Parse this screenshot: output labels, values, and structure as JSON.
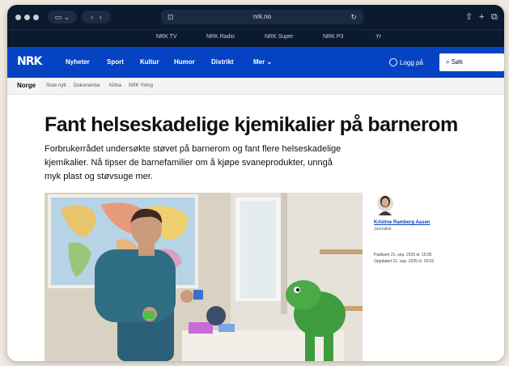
{
  "browser": {
    "url": "nrk.no",
    "colors": {
      "toolbar": "#0b1a2f",
      "accent": "#0643c2"
    }
  },
  "services": [
    "NRK TV",
    "NRK Radio",
    "NRK Super",
    "NRK P3",
    "Yr"
  ],
  "nav": {
    "logo": "NRK",
    "items": [
      "Nyheter",
      "Sport",
      "Kultur",
      "Humor",
      "Distrikt",
      "Mer"
    ],
    "login": "Logg på",
    "search": "Søk"
  },
  "subnav": {
    "title": "Norge",
    "items": [
      "Siste nytt",
      "Dokumentar",
      "Klima",
      "NRK Ytring"
    ]
  },
  "article": {
    "headline": "Fant helseskadelige kjemikalier på barnerom",
    "lead": "Forbrukerrådet undersøkte støvet på barnerom og fant flere helseskadelige kjemikalier. Nå tipser de barnefamilier om å kjøpe svaneprodukter, unngå myk plast og støvsuge mer.",
    "author": "Kristine Ramberg Aasen",
    "author_role": "Journalist",
    "published": "Publisert 21. sep. 2025 kl. 15:00",
    "updated": "Oppdatert 21. sep. 2025 kl. 20:02"
  }
}
